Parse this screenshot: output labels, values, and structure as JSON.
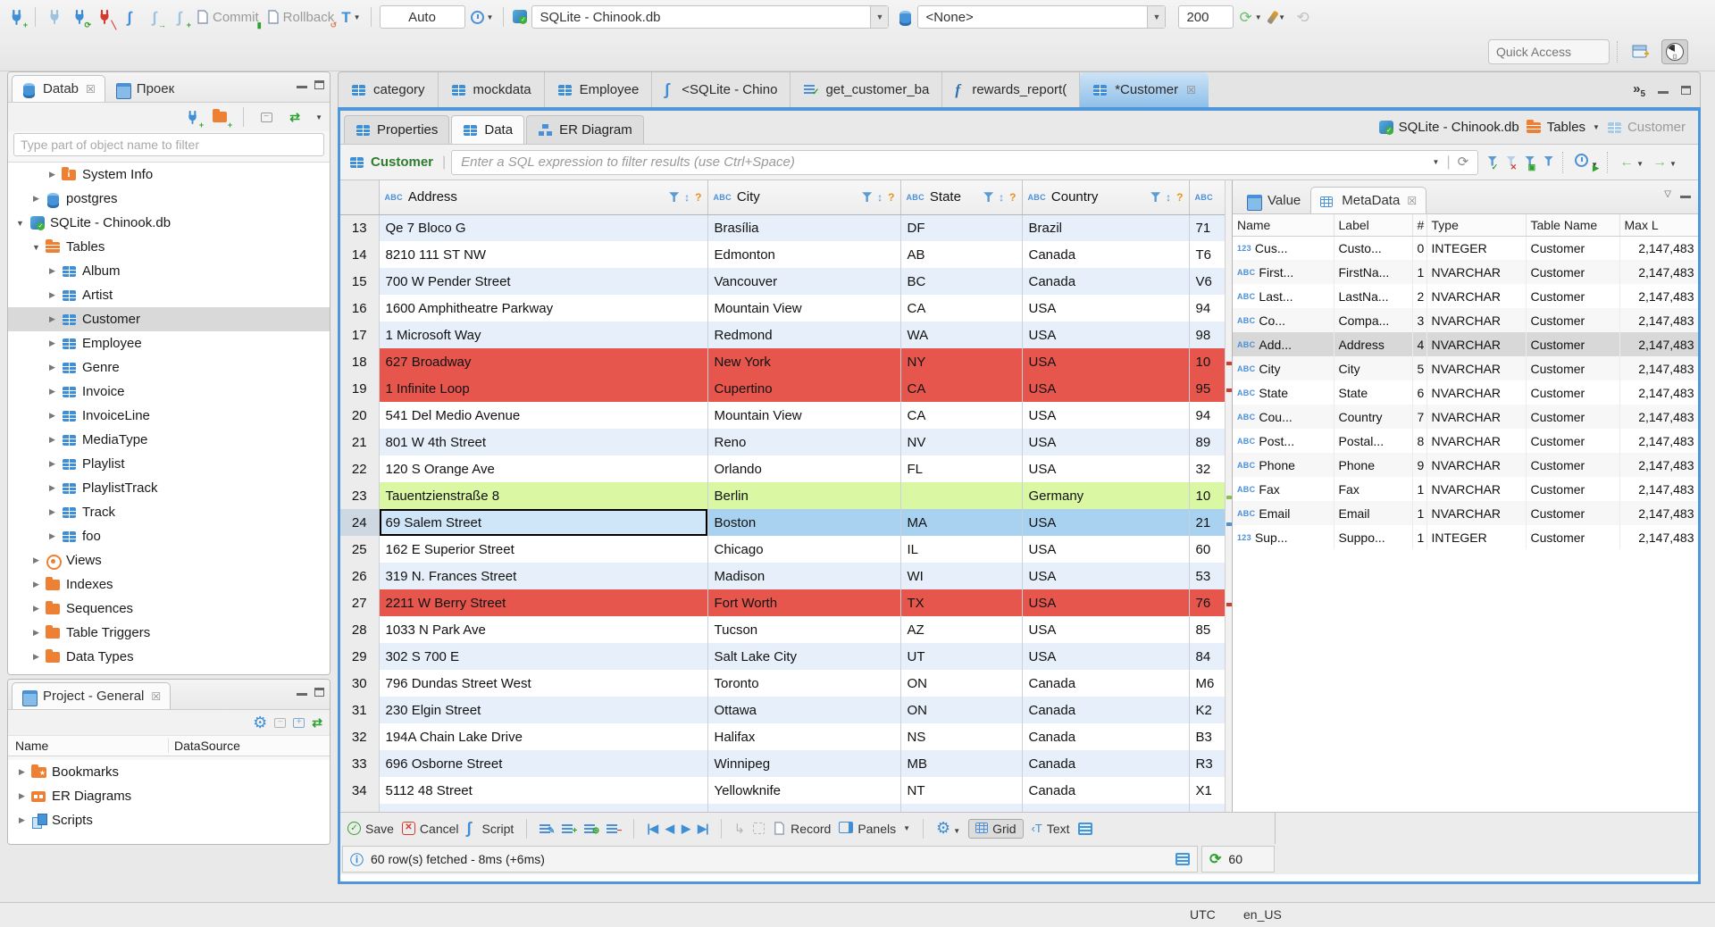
{
  "toolbar": {
    "commit": "Commit",
    "rollback": "Rollback",
    "auto": "Auto",
    "connection": "SQLite - Chinook.db",
    "schema": "<None>",
    "fetch_size": "200",
    "quick_access_placeholder": "Quick Access"
  },
  "navigator": {
    "tab_database": "Datab",
    "tab_project": "Проек",
    "filter_placeholder": "Type part of object name to filter",
    "tree": [
      {
        "label": "System Info",
        "icon": "folder-info",
        "depth": 2,
        "arrow": "right"
      },
      {
        "label": "postgres",
        "icon": "db",
        "depth": 1,
        "arrow": "right"
      },
      {
        "label": "SQLite - Chinook.db",
        "icon": "sqlite",
        "depth": 0,
        "arrow": "down"
      },
      {
        "label": "Tables",
        "icon": "folder-table",
        "depth": 1,
        "arrow": "down"
      },
      {
        "label": "Album",
        "icon": "table",
        "depth": 2,
        "arrow": "right"
      },
      {
        "label": "Artist",
        "icon": "table",
        "depth": 2,
        "arrow": "right"
      },
      {
        "label": "Customer",
        "icon": "table",
        "depth": 2,
        "arrow": "right",
        "selected": true
      },
      {
        "label": "Employee",
        "icon": "table",
        "depth": 2,
        "arrow": "right"
      },
      {
        "label": "Genre",
        "icon": "table",
        "depth": 2,
        "arrow": "right"
      },
      {
        "label": "Invoice",
        "icon": "table",
        "depth": 2,
        "arrow": "right"
      },
      {
        "label": "InvoiceLine",
        "icon": "table",
        "depth": 2,
        "arrow": "right"
      },
      {
        "label": "MediaType",
        "icon": "table",
        "depth": 2,
        "arrow": "right"
      },
      {
        "label": "Playlist",
        "icon": "table",
        "depth": 2,
        "arrow": "right"
      },
      {
        "label": "PlaylistTrack",
        "icon": "table",
        "depth": 2,
        "arrow": "right"
      },
      {
        "label": "Track",
        "icon": "table",
        "depth": 2,
        "arrow": "right"
      },
      {
        "label": "foo",
        "icon": "table",
        "depth": 2,
        "arrow": "right"
      },
      {
        "label": "Views",
        "icon": "eye",
        "depth": 1,
        "arrow": "right"
      },
      {
        "label": "Indexes",
        "icon": "folder",
        "depth": 1,
        "arrow": "right"
      },
      {
        "label": "Sequences",
        "icon": "folder",
        "depth": 1,
        "arrow": "right"
      },
      {
        "label": "Table Triggers",
        "icon": "folder",
        "depth": 1,
        "arrow": "right"
      },
      {
        "label": "Data Types",
        "icon": "folder",
        "depth": 1,
        "arrow": "right"
      }
    ]
  },
  "project": {
    "title": "Project - General",
    "col_name": "Name",
    "col_datasource": "DataSource",
    "items": [
      {
        "label": "Bookmarks",
        "icon": "folder-star"
      },
      {
        "label": "ER Diagrams",
        "icon": "er"
      },
      {
        "label": "Scripts",
        "icon": "scripts"
      }
    ]
  },
  "editor_tabs": [
    {
      "label": "category",
      "icon": "table"
    },
    {
      "label": "mockdata",
      "icon": "table"
    },
    {
      "label": "Employee",
      "icon": "table"
    },
    {
      "label": "<SQLite - Chino",
      "icon": "scroll"
    },
    {
      "label": "get_customer_ba",
      "icon": "sqlcheck"
    },
    {
      "label": "rewards_report(",
      "icon": "func"
    },
    {
      "label": "*Customer",
      "icon": "table",
      "active": true,
      "closable": true
    }
  ],
  "tab_overflow_count": "5",
  "subtabs": [
    {
      "label": "Properties",
      "icon": "table"
    },
    {
      "label": "Data",
      "icon": "table",
      "active": true
    },
    {
      "label": "ER Diagram",
      "icon": "erd"
    }
  ],
  "breadcrumb": {
    "connection": "SQLite - Chinook.db",
    "container": "Tables",
    "object": "Customer"
  },
  "filter": {
    "table": "Customer",
    "placeholder": "Enter a SQL expression to filter results (use Ctrl+Space)"
  },
  "grid": {
    "columns": [
      "Address",
      "City",
      "State",
      "Country",
      ""
    ],
    "rows": [
      {
        "num": 13,
        "address": "Qe 7 Bloco G",
        "city": "Brasília",
        "state": "DF",
        "country": "Brazil",
        "postal": "71",
        "color": "stripe"
      },
      {
        "num": 14,
        "address": "8210 111 ST NW",
        "city": "Edmonton",
        "state": "AB",
        "country": "Canada",
        "postal": "T6",
        "color": "plain"
      },
      {
        "num": 15,
        "address": "700 W Pender Street",
        "city": "Vancouver",
        "state": "BC",
        "country": "Canada",
        "postal": "V6",
        "color": "stripe"
      },
      {
        "num": 16,
        "address": "1600 Amphitheatre Parkway",
        "city": "Mountain View",
        "state": "CA",
        "country": "USA",
        "postal": "94",
        "color": "plain"
      },
      {
        "num": 17,
        "address": "1 Microsoft Way",
        "city": "Redmond",
        "state": "WA",
        "country": "USA",
        "postal": "98",
        "color": "stripe"
      },
      {
        "num": 18,
        "address": "627 Broadway",
        "city": "New York",
        "state": "NY",
        "country": "USA",
        "postal": "10",
        "color": "red"
      },
      {
        "num": 19,
        "address": "1 Infinite Loop",
        "city": "Cupertino",
        "state": "CA",
        "country": "USA",
        "postal": "95",
        "color": "red"
      },
      {
        "num": 20,
        "address": "541 Del Medio Avenue",
        "city": "Mountain View",
        "state": "CA",
        "country": "USA",
        "postal": "94",
        "color": "plain"
      },
      {
        "num": 21,
        "address": "801 W 4th Street",
        "city": "Reno",
        "state": "NV",
        "country": "USA",
        "postal": "89",
        "color": "stripe"
      },
      {
        "num": 22,
        "address": "120 S Orange Ave",
        "city": "Orlando",
        "state": "FL",
        "country": "USA",
        "postal": "32",
        "color": "plain"
      },
      {
        "num": 23,
        "address": "Tauentzienstraße 8",
        "city": "Berlin",
        "state": "",
        "country": "Germany",
        "postal": "10",
        "color": "green"
      },
      {
        "num": 24,
        "address": "69 Salem Street",
        "city": "Boston",
        "state": "MA",
        "country": "USA",
        "postal": "21",
        "color": "selected",
        "focused": true
      },
      {
        "num": 25,
        "address": "162 E Superior Street",
        "city": "Chicago",
        "state": "IL",
        "country": "USA",
        "postal": "60",
        "color": "plain"
      },
      {
        "num": 26,
        "address": "319 N. Frances Street",
        "city": "Madison",
        "state": "WI",
        "country": "USA",
        "postal": "53",
        "color": "stripe"
      },
      {
        "num": 27,
        "address": "2211 W Berry Street",
        "city": "Fort Worth",
        "state": "TX",
        "country": "USA",
        "postal": "76",
        "color": "red"
      },
      {
        "num": 28,
        "address": "1033 N Park Ave",
        "city": "Tucson",
        "state": "AZ",
        "country": "USA",
        "postal": "85",
        "color": "plain"
      },
      {
        "num": 29,
        "address": "302 S 700 E",
        "city": "Salt Lake City",
        "state": "UT",
        "country": "USA",
        "postal": "84",
        "color": "stripe"
      },
      {
        "num": 30,
        "address": "796 Dundas Street West",
        "city": "Toronto",
        "state": "ON",
        "country": "Canada",
        "postal": "M6",
        "color": "plain"
      },
      {
        "num": 31,
        "address": "230 Elgin Street",
        "city": "Ottawa",
        "state": "ON",
        "country": "Canada",
        "postal": "K2",
        "color": "stripe"
      },
      {
        "num": 32,
        "address": "194A Chain Lake Drive",
        "city": "Halifax",
        "state": "NS",
        "country": "Canada",
        "postal": "B3",
        "color": "plain"
      },
      {
        "num": 33,
        "address": "696 Osborne Street",
        "city": "Winnipeg",
        "state": "MB",
        "country": "Canada",
        "postal": "R3",
        "color": "stripe"
      },
      {
        "num": 34,
        "address": "5112 48 Street",
        "city": "Yellowknife",
        "state": "NT",
        "country": "Canada",
        "postal": "X1",
        "color": "plain"
      }
    ]
  },
  "metadata": {
    "tab_value": "Value",
    "tab_meta": "MetaData",
    "columns": [
      "Name",
      "Label",
      "#",
      "Type",
      "Table Name",
      "Max L"
    ],
    "rows": [
      {
        "kind": "123",
        "name": "Cus...",
        "label": "Custo...",
        "num": "0",
        "type": "INTEGER",
        "table": "Customer",
        "max": "2,147,483"
      },
      {
        "kind": "ABC",
        "name": "First...",
        "label": "FirstNa...",
        "num": "1",
        "type": "NVARCHAR",
        "table": "Customer",
        "max": "2,147,483"
      },
      {
        "kind": "ABC",
        "name": "Last...",
        "label": "LastNa...",
        "num": "2",
        "type": "NVARCHAR",
        "table": "Customer",
        "max": "2,147,483"
      },
      {
        "kind": "ABC",
        "name": "Co...",
        "label": "Compa...",
        "num": "3",
        "type": "NVARCHAR",
        "table": "Customer",
        "max": "2,147,483"
      },
      {
        "kind": "ABC",
        "name": "Add...",
        "label": "Address",
        "num": "4",
        "type": "NVARCHAR",
        "table": "Customer",
        "max": "2,147,483",
        "selected": true
      },
      {
        "kind": "ABC",
        "name": "City",
        "label": "City",
        "num": "5",
        "type": "NVARCHAR",
        "table": "Customer",
        "max": "2,147,483"
      },
      {
        "kind": "ABC",
        "name": "State",
        "label": "State",
        "num": "6",
        "type": "NVARCHAR",
        "table": "Customer",
        "max": "2,147,483"
      },
      {
        "kind": "ABC",
        "name": "Cou...",
        "label": "Country",
        "num": "7",
        "type": "NVARCHAR",
        "table": "Customer",
        "max": "2,147,483"
      },
      {
        "kind": "ABC",
        "name": "Post...",
        "label": "Postal...",
        "num": "8",
        "type": "NVARCHAR",
        "table": "Customer",
        "max": "2,147,483"
      },
      {
        "kind": "ABC",
        "name": "Phone",
        "label": "Phone",
        "num": "9",
        "type": "NVARCHAR",
        "table": "Customer",
        "max": "2,147,483"
      },
      {
        "kind": "ABC",
        "name": "Fax",
        "label": "Fax",
        "num": "1",
        "type": "NVARCHAR",
        "table": "Customer",
        "max": "2,147,483"
      },
      {
        "kind": "ABC",
        "name": "Email",
        "label": "Email",
        "num": "1",
        "type": "NVARCHAR",
        "table": "Customer",
        "max": "2,147,483"
      },
      {
        "kind": "123",
        "name": "Sup...",
        "label": "Suppo...",
        "num": "1",
        "type": "INTEGER",
        "table": "Customer",
        "max": "2,147,483"
      }
    ]
  },
  "bottom_toolbar": {
    "save": "Save",
    "cancel": "Cancel",
    "script": "Script",
    "record": "Record",
    "panels": "Panels",
    "grid": "Grid",
    "text": "Text"
  },
  "status": {
    "fetch_message": "60 row(s) fetched - 8ms (+6ms)",
    "refresh_count": "60"
  },
  "winstatus": {
    "timezone": "UTC",
    "locale": "en_US"
  }
}
